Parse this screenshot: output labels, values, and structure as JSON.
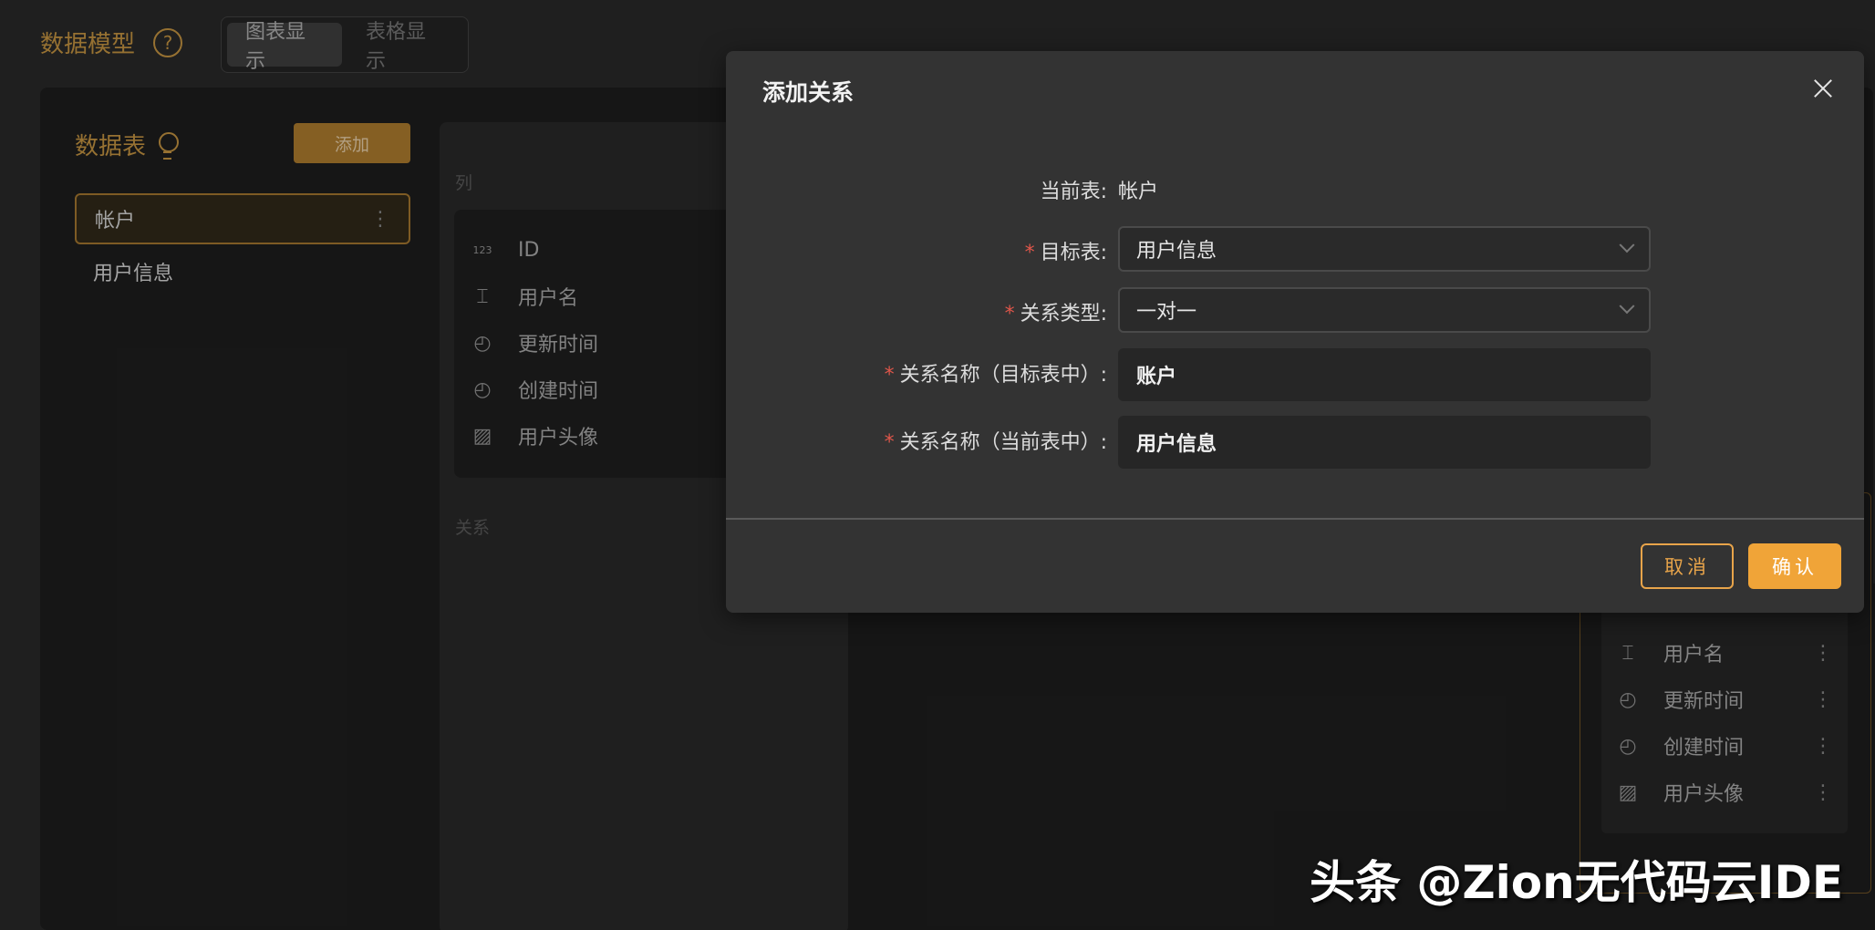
{
  "header": {
    "title": "数据模型",
    "view_tabs": [
      {
        "label": "图表显示",
        "active": true
      },
      {
        "label": "表格显示",
        "active": false
      }
    ]
  },
  "tables_panel": {
    "title": "数据表",
    "add_label": "添加",
    "items": [
      {
        "label": "帐户",
        "selected": true
      },
      {
        "label": "用户信息",
        "selected": false
      }
    ]
  },
  "columns_panel": {
    "columns_label": "列",
    "relations_label": "关系",
    "columns": [
      {
        "icon": "number-icon",
        "glyph": "123",
        "label": "ID"
      },
      {
        "icon": "text-field-icon",
        "glyph": "⌶",
        "label": "用户名"
      },
      {
        "icon": "clock-icon",
        "glyph": "◴",
        "label": "更新时间"
      },
      {
        "icon": "clock-icon",
        "glyph": "◴",
        "label": "创建时间"
      },
      {
        "icon": "image-icon",
        "glyph": "▨",
        "label": "用户头像"
      }
    ]
  },
  "right_card": {
    "rows": [
      {
        "icon": "text-field-icon",
        "glyph": "⌶",
        "label": "用户名"
      },
      {
        "icon": "clock-icon",
        "glyph": "◴",
        "label": "更新时间"
      },
      {
        "icon": "clock-icon",
        "glyph": "◴",
        "label": "创建时间"
      },
      {
        "icon": "image-icon",
        "glyph": "▨",
        "label": "用户头像"
      }
    ]
  },
  "dialog": {
    "title": "添加关系",
    "current_table_label": "当前表:",
    "current_table_value": "帐户",
    "required_mark": "*",
    "target_table_label": "目标表:",
    "target_table_value": "用户信息",
    "relation_type_label": "关系类型:",
    "relation_type_value": "一对一",
    "name_in_target_label": "关系名称（目标表中）:",
    "name_in_target_value": "账户",
    "name_in_current_label": "关系名称（当前表中）:",
    "name_in_current_value": "用户信息",
    "cancel_label": "取消",
    "confirm_label": "确认"
  },
  "watermark": "头条 @Zion无代码云IDE",
  "colors": {
    "accent": "#f0a438",
    "brand_gold": "#b78a3d",
    "required": "#e0564a",
    "dialog_bg": "#333333"
  }
}
